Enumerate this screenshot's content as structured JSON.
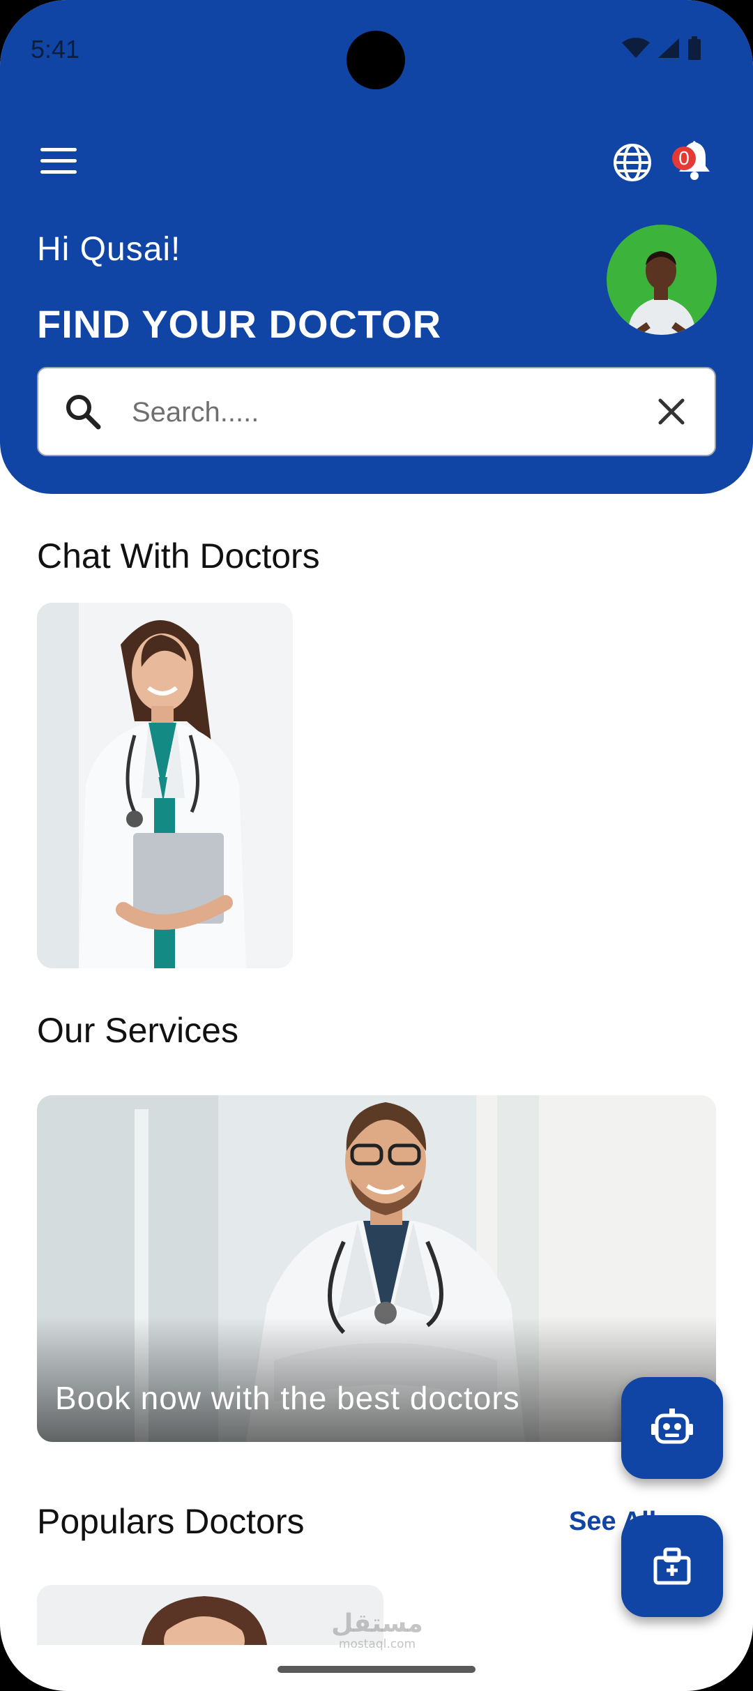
{
  "status_bar": {
    "time": "5:41"
  },
  "header": {
    "notification_count": "0",
    "greeting": "Hi  Qusai!",
    "title": "FIND YOUR DOCTOR"
  },
  "search": {
    "placeholder": "Search....."
  },
  "sections": {
    "chat": "Chat With Doctors",
    "services": "Our Services",
    "popular": "Populars Doctors"
  },
  "service_card": {
    "caption": "Book now with the best doctors"
  },
  "popular": {
    "see_all": "See All"
  },
  "watermark": {
    "arabic": "مستقل",
    "latin": "mostaql.com"
  },
  "colors": {
    "primary": "#1145a5",
    "avatar_bg": "#3cb43c",
    "badge": "#e53935"
  },
  "icons": {
    "menu": "menu-icon",
    "language": "globe-icon",
    "notifications": "bell-icon",
    "search": "search-icon",
    "clear": "close-icon",
    "chatbot": "robot-icon",
    "appointment": "medical-card-icon"
  }
}
